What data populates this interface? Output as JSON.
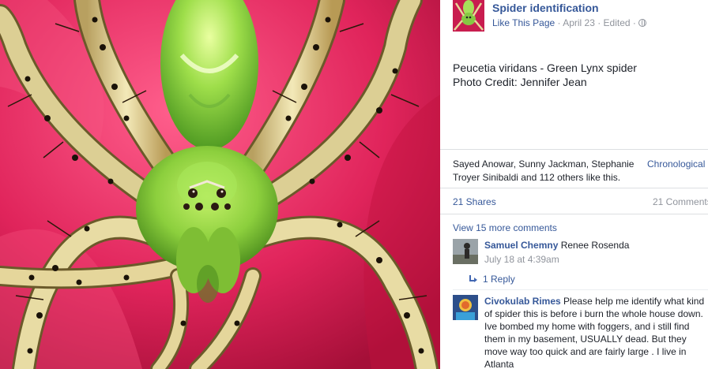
{
  "post": {
    "page_name": "Spider identification",
    "like_link": "Like This Page",
    "date": "April 23",
    "edited": "Edited",
    "separator": " · ",
    "caption_line1": "Peucetia viridans - Green Lynx spider",
    "caption_line2": "Photo Credit: Jennifer Jean"
  },
  "reactions": {
    "likes_text": "Sayed Anowar, Sunny Jackman, Stephanie Troyer Sinibaldi and 112 others like this.",
    "sort_label": "Chronological",
    "shares": "21 Shares",
    "comments": "21 Comments"
  },
  "comments": {
    "view_more": "View 15 more comments",
    "items": [
      {
        "author": "Samuel Chemny",
        "text": "Renee Rosenda",
        "time": "July 18 at 4:39am",
        "replies": "1 Reply"
      },
      {
        "author": "Civokulab Rimes",
        "text": "Please help me identify what kind of spider this is before i burn the whole house down. Ive bombed my home with foggers, and i still find them in my basement, USUALLY dead. But they move way too quick and are fairly large . I live in Atlanta"
      }
    ]
  },
  "colors": {
    "link_blue": "#365899",
    "meta_gray": "#90949c",
    "petal_pink": "#d81d55",
    "spider_green": "#8fd14f"
  },
  "icons": {
    "globe": "globe-icon",
    "reply": "reply-arrow-icon"
  }
}
